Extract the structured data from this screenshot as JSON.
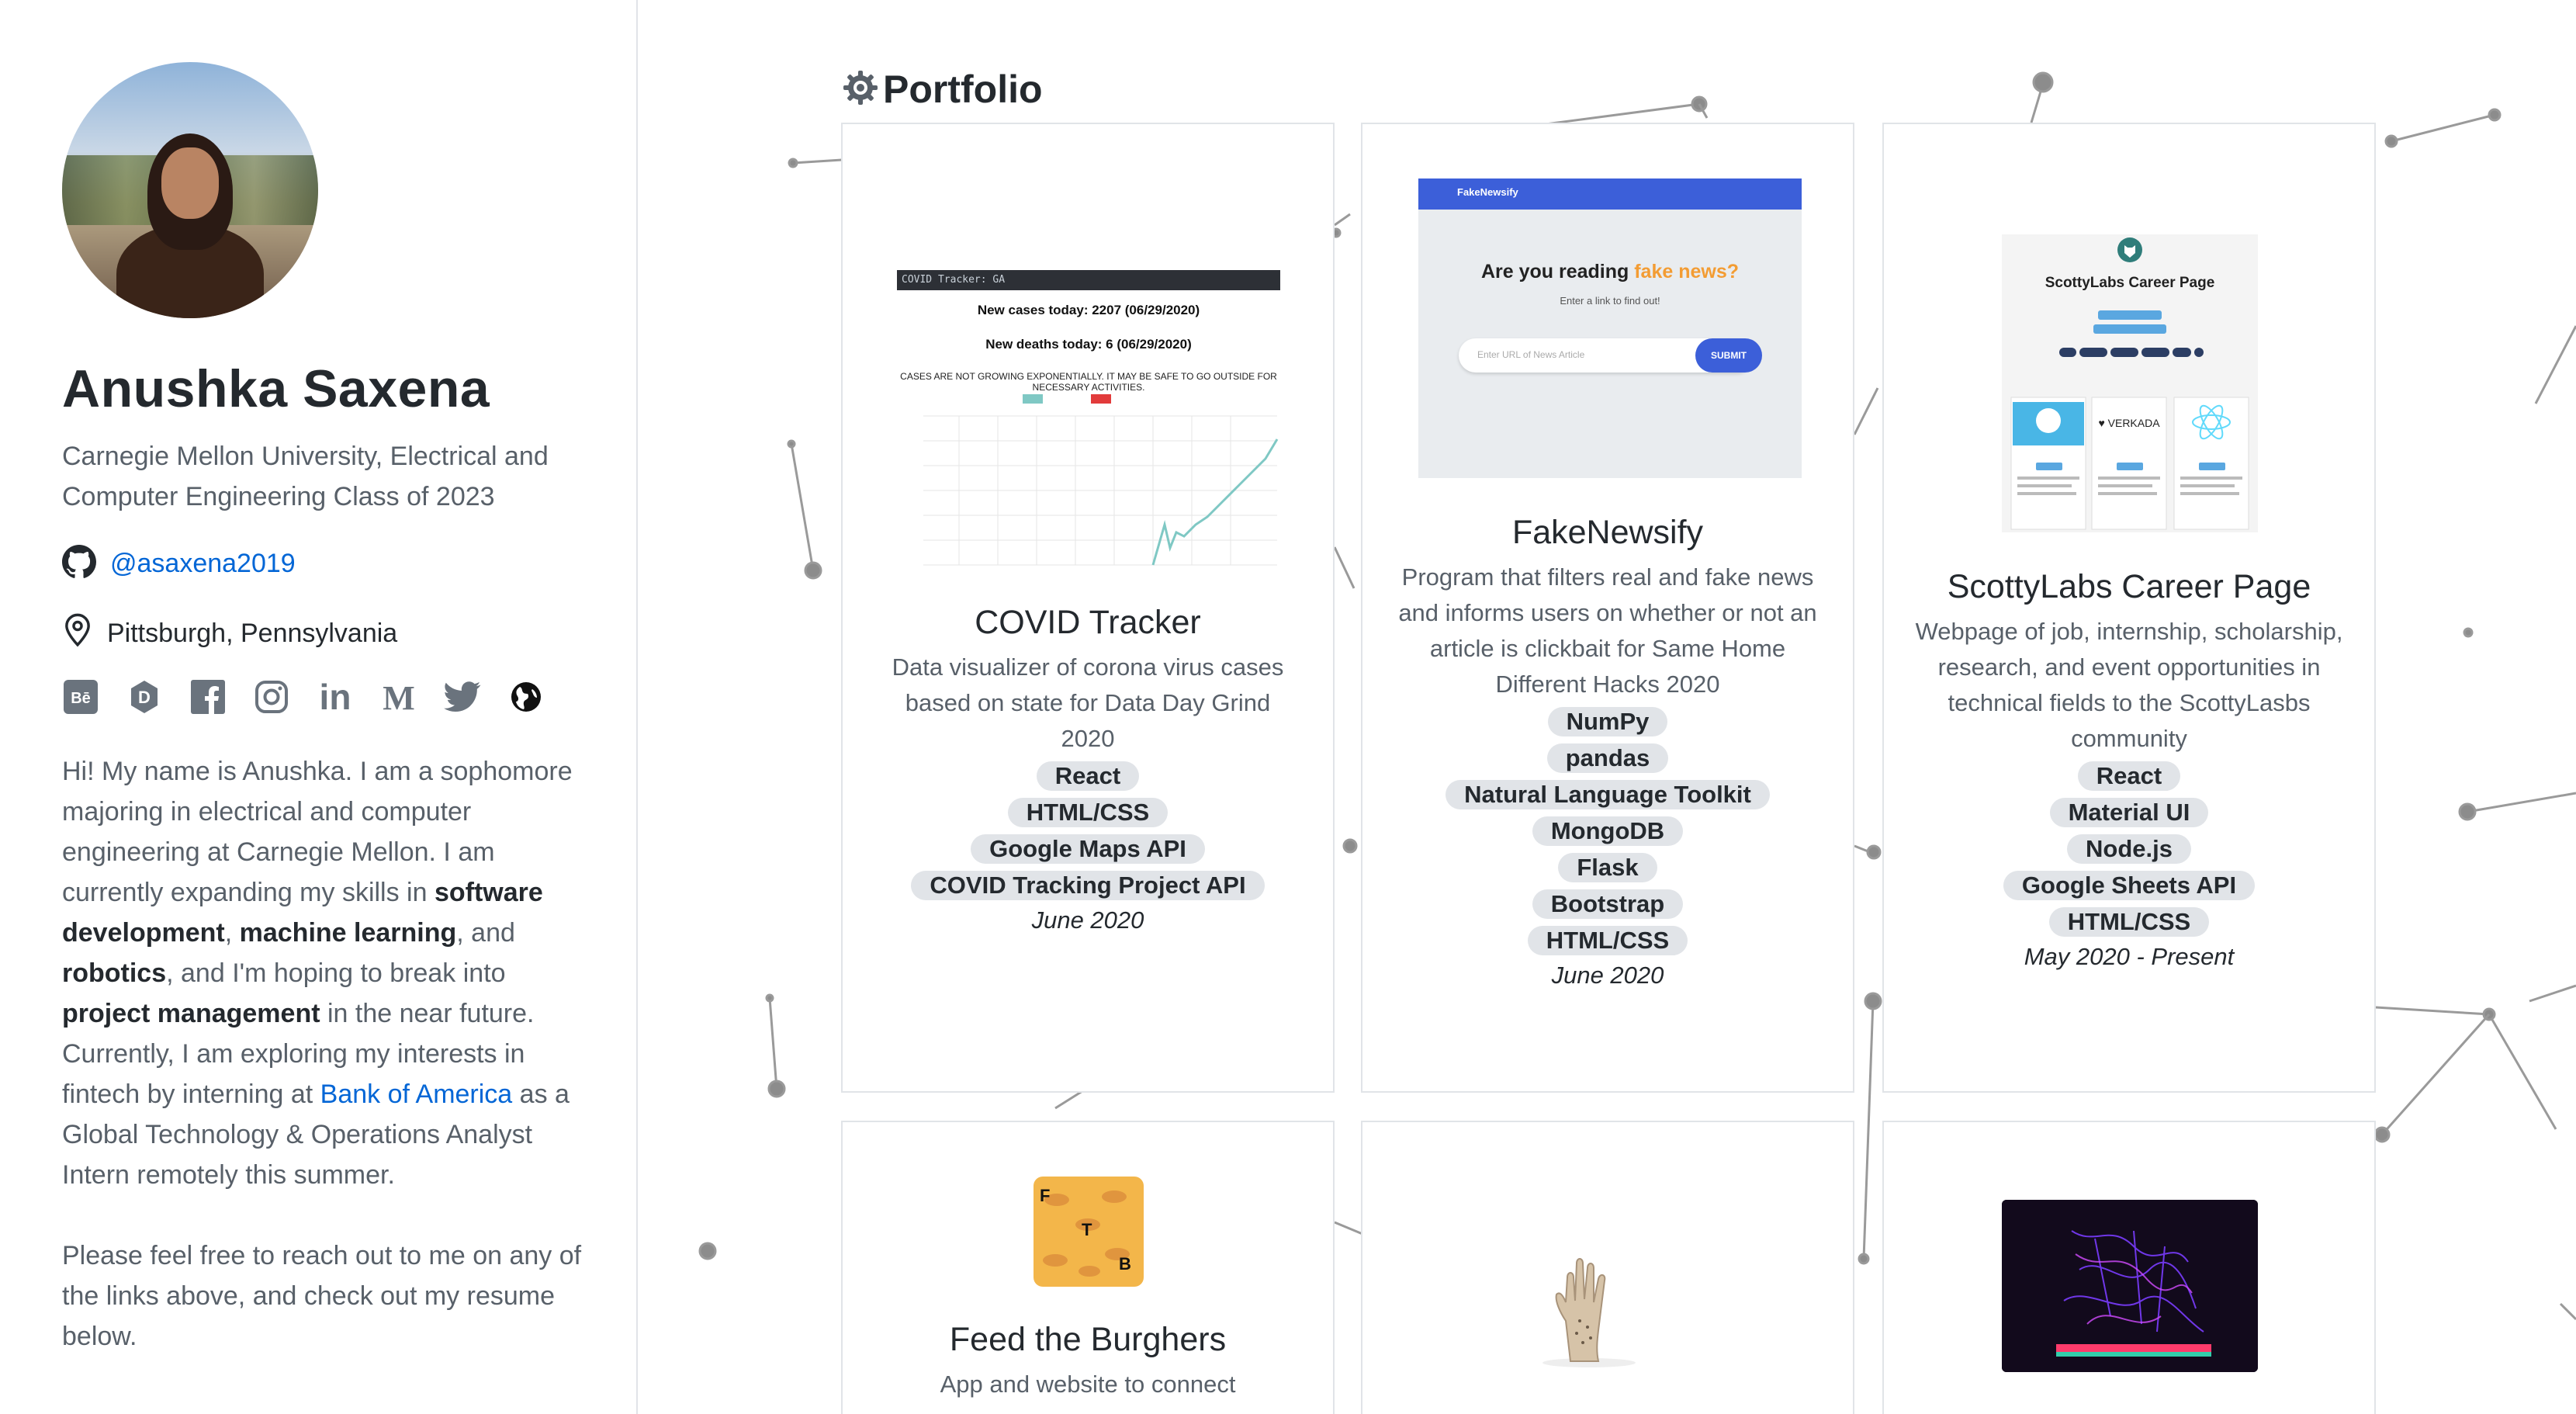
{
  "profile": {
    "name": "Anushka Saxena",
    "tagline": "Carnegie Mellon University, Electrical and Computer Engineering Class of 2023",
    "github_handle": "@asaxena2019",
    "location": "Pittsburgh, Pennsylvania"
  },
  "social_icons": [
    "behance-icon",
    "dribbble-d-icon",
    "facebook-icon",
    "instagram-icon",
    "linkedin-icon",
    "medium-icon",
    "twitter-icon",
    "globe-icon"
  ],
  "bio": {
    "p1_a": "Hi! My name is Anushka. I am a sophomore majoring in electrical and computer engineering at Carnegie Mellon. I am currently expanding my skills in ",
    "p1_b1": "software development",
    "p1_c": ", ",
    "p1_b2": "machine learning",
    "p1_d": ", and ",
    "p1_b3": "robotics",
    "p1_e": ", and I'm hoping to break into ",
    "p1_b4": "project management",
    "p1_f": " in the near future. Currently, I am exploring my interests in fintech by interning at ",
    "p1_link": "Bank of America",
    "p1_g": " as a Global Technology & Operations Analyst Intern remotely this summer.",
    "p2": "Please feel free to reach out to me on any of the links above, and check out my resume below."
  },
  "portfolio": {
    "title": "Portfolio",
    "cards": [
      {
        "title": "COVID Tracker",
        "description": "Data visualizer of corona virus cases based on state for Data Day Grind 2020",
        "tags": [
          "React",
          "HTML/CSS",
          "Google Maps API",
          "COVID Tracking Project API"
        ],
        "date": "June 2020",
        "thumb": {
          "bar": "COVID Tracker: GA",
          "line1": "New cases today: 2207 (06/29/2020)",
          "line2": "New deaths today: 6 (06/29/2020)",
          "warning": "CASES ARE NOT GROWING EXPONENTIALLY. IT MAY BE SAFE TO GO OUTSIDE FOR NECESSARY ACTIVITIES."
        }
      },
      {
        "title": "FakeNewsify",
        "description": "Program that filters real and fake news and informs users on whether or not an article is clickbait for Same Home Different Hacks 2020",
        "tags": [
          "NumPy",
          "pandas",
          "Natural Language Toolkit",
          "MongoDB",
          "Flask",
          "Bootstrap",
          "HTML/CSS"
        ],
        "date": "June 2020",
        "thumb": {
          "brand": "FakeNewsify",
          "q_a": "Are you reading ",
          "q_b": "fake news?",
          "sub": "Enter a link to find out!",
          "placeholder": "Enter URL of News Article",
          "button": "SUBMIT"
        }
      },
      {
        "title": "ScottyLabs Career Page",
        "description": "Webpage of job, internship, scholarship, research, and event opportunities in technical fields to the ScottyLasbs community",
        "tags": [
          "React",
          "Material UI",
          "Node.js",
          "Google Sheets API",
          "HTML/CSS"
        ],
        "date": "May 2020 - Present",
        "thumb": {
          "title": "ScottyLabs Career Page"
        }
      },
      {
        "title": "Feed the Burghers",
        "description": "App and website to connect",
        "thumb": {
          "letters": [
            "F",
            "T",
            "B"
          ]
        }
      },
      {
        "title": "",
        "description": ""
      },
      {
        "title": "",
        "description": ""
      }
    ]
  },
  "colors": {
    "link": "#0366d6",
    "tag_bg": "#e1e4e8",
    "text": "#24292e",
    "muted": "#586069",
    "network": "#9a9a9a"
  }
}
